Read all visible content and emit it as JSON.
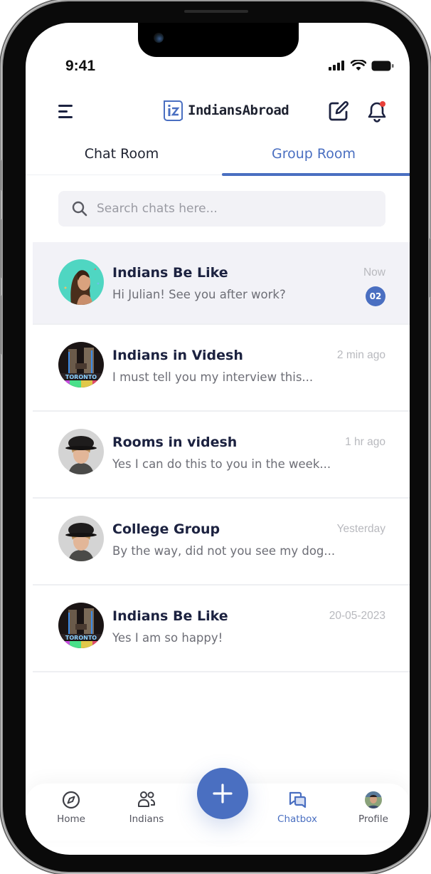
{
  "status_bar": {
    "time": "9:41"
  },
  "header": {
    "app_name": "IndiansAbroad",
    "icons": [
      "menu-icon",
      "compose-icon",
      "bell-icon"
    ],
    "notification_dot_color": "#e8403a"
  },
  "tabs": [
    {
      "label": "Chat Room",
      "active": false
    },
    {
      "label": "Group Room",
      "active": true
    }
  ],
  "search": {
    "placeholder": "Search chats here...",
    "value": ""
  },
  "chats": [
    {
      "name": "Indians Be Like",
      "message": "Hi Julian! See you after work?",
      "time": "Now",
      "unread": "02",
      "avatar": "woman-portrait",
      "highlighted": true
    },
    {
      "name": "Indians in Videsh",
      "message": "I must tell you my interview this...",
      "time": "2 min ago",
      "avatar": "toronto-city-hall"
    },
    {
      "name": "Rooms in videsh",
      "message": "Yes I can do this to you in the week...",
      "time": "1 hr ago",
      "avatar": "man-hat-portrait"
    },
    {
      "name": "College Group",
      "message": "By the way, did not you see my dog...",
      "time": "Yesterday",
      "avatar": "man-hat-portrait"
    },
    {
      "name": "Indians Be Like",
      "message": "Yes I am so happy!",
      "time": "20-05-2023",
      "avatar": "toronto-city-hall"
    }
  ],
  "bottom_nav": [
    {
      "label": "Home",
      "icon": "compass-icon",
      "active": false
    },
    {
      "label": "Indians",
      "icon": "users-icon",
      "active": false
    },
    {
      "label": "Chatbox",
      "icon": "chat-bubbles-icon",
      "active": true
    },
    {
      "label": "Profile",
      "icon": "profile-avatar",
      "active": false
    }
  ],
  "fab": {
    "icon": "plus-icon"
  },
  "colors": {
    "accent": "#4a6fc1",
    "text_dark": "#1c2240",
    "text_muted": "#6d6e76",
    "timestamp": "#b8b9be",
    "highlight_bg": "#f2f2f7"
  }
}
